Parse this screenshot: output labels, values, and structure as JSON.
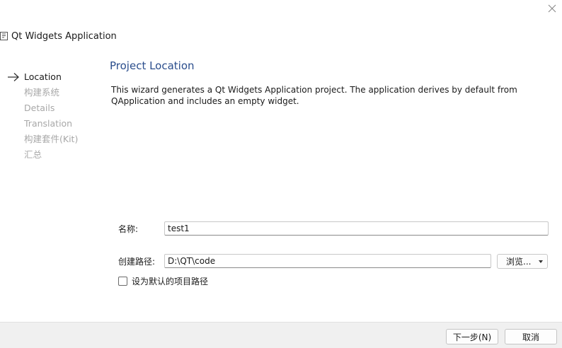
{
  "window": {
    "title": "Qt Widgets Application"
  },
  "steps": [
    {
      "label": "Location",
      "current": true
    },
    {
      "label": "构建系统",
      "current": false
    },
    {
      "label": "Details",
      "current": false
    },
    {
      "label": "Translation",
      "current": false
    },
    {
      "label": "构建套件(Kit)",
      "current": false
    },
    {
      "label": "汇总",
      "current": false
    }
  ],
  "page": {
    "title": "Project Location",
    "description": "This wizard generates a Qt Widgets Application project. The application derives by default from QApplication and includes an empty widget."
  },
  "form": {
    "name_label": "名称:",
    "name_value": "test1",
    "path_label": "创建路径:",
    "path_value": "D:\\QT\\code",
    "browse_label": "浏览...",
    "default_path_label": "设为默认的项目路径"
  },
  "footer": {
    "next_label": "下一步(N)",
    "cancel_label": "取消"
  },
  "colors": {
    "accent_title": "#2a4d8c",
    "disabled_step": "#a8a8a8",
    "footer_bg": "#f0f0f0"
  }
}
